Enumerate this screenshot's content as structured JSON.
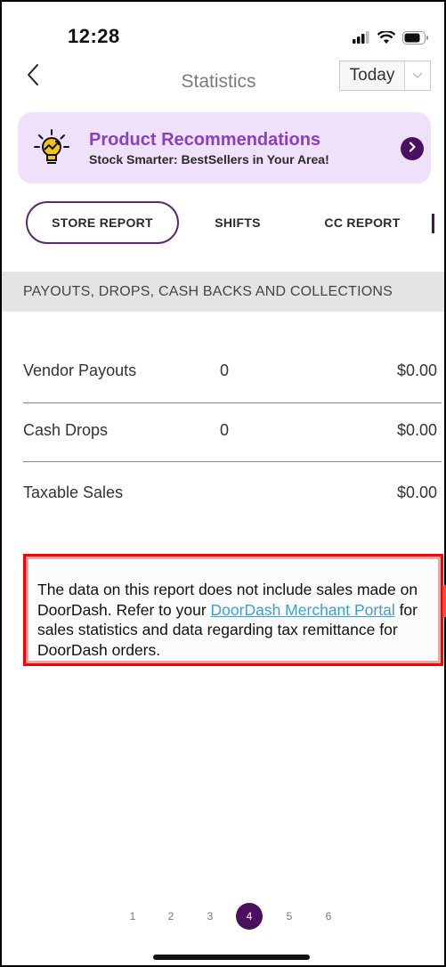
{
  "status_bar": {
    "time": "12:28",
    "icons": [
      "signal-icon",
      "wifi-icon",
      "battery-icon"
    ]
  },
  "nav": {
    "title": "Statistics",
    "period": "Today",
    "back_icon": "chevron-left-icon",
    "period_arrow_icon": "chevron-down-icon"
  },
  "promo": {
    "title": "Product Recommendations",
    "subtitle": "Stock Smarter: BestSellers in Your Area!",
    "icon": "lightbulb-icon",
    "arrow_icon": "chevron-right-icon",
    "title_color": "#8a3fc1",
    "background": "#efe1fb"
  },
  "tabs": [
    {
      "label": "STORE REPORT",
      "active": true
    },
    {
      "label": "SHIFTS",
      "active": false
    },
    {
      "label": "CC REPORT",
      "active": false
    }
  ],
  "section": {
    "header": "PAYOUTS, DROPS, CASH BACKS AND COLLECTIONS",
    "rows": [
      {
        "label": "Vendor Payouts",
        "count": "0",
        "amount": "$0.00"
      },
      {
        "label": "Cash Drops",
        "count": "0",
        "amount": "$0.00"
      },
      {
        "label": "Taxable Sales",
        "count": "",
        "amount": "$0.00"
      }
    ]
  },
  "notice": {
    "text_before": "The data on this report does not include sales made on DoorDash. Refer to your ",
    "link_text": "DoorDash Merchant Portal",
    "text_after": " for sales statistics and data regarding tax remittance for DoorDash orders.",
    "border_color": "#ff0000"
  },
  "pagination": {
    "pages": [
      "1",
      "2",
      "3",
      "4",
      "5",
      "6"
    ],
    "current": "4",
    "active_color": "#4a0f5e"
  }
}
